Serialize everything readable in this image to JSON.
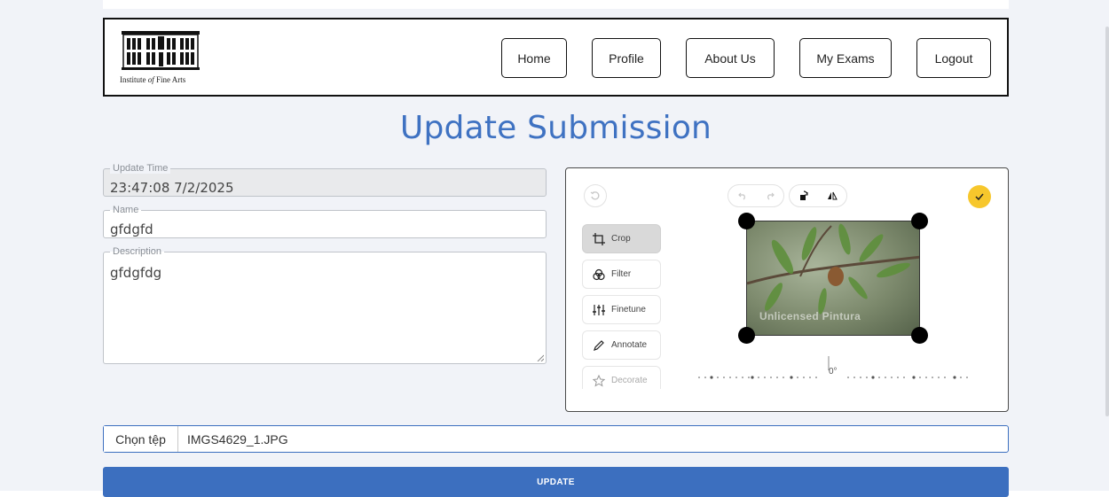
{
  "header": {
    "logo_caption_pre": "Institute ",
    "logo_caption_em": "of",
    "logo_caption_post": " Fine Arts",
    "nav": [
      {
        "label": "Home"
      },
      {
        "label": "Profile"
      },
      {
        "label": "About Us"
      },
      {
        "label": "My Exams"
      },
      {
        "label": "Logout"
      }
    ]
  },
  "page": {
    "title": "Update Submission"
  },
  "form": {
    "update_time": {
      "label": "Update Time",
      "value": "23:47:08 7/2/2025"
    },
    "name": {
      "label": "Name",
      "value": "gfdgfd"
    },
    "description": {
      "label": "Description",
      "value": "gfdgfdg"
    }
  },
  "editor": {
    "tools": [
      {
        "label": "Crop",
        "icon": "crop-icon",
        "active": true
      },
      {
        "label": "Filter",
        "icon": "filter-icon"
      },
      {
        "label": "Finetune",
        "icon": "finetune-icon"
      },
      {
        "label": "Annotate",
        "icon": "pencil-icon"
      },
      {
        "label": "Decorate",
        "icon": "star-icon"
      }
    ],
    "watermark": "Unlicensed Pintura",
    "rotation_label": "0°",
    "done_color": "#f7c72c"
  },
  "file": {
    "button_label": "Chọn tệp",
    "file_name": "IMGS4629_1.JPG"
  },
  "actions": {
    "update_label": "UPDATE"
  },
  "colors": {
    "accent": "#3c6fbf",
    "title": "#3f72c2"
  }
}
